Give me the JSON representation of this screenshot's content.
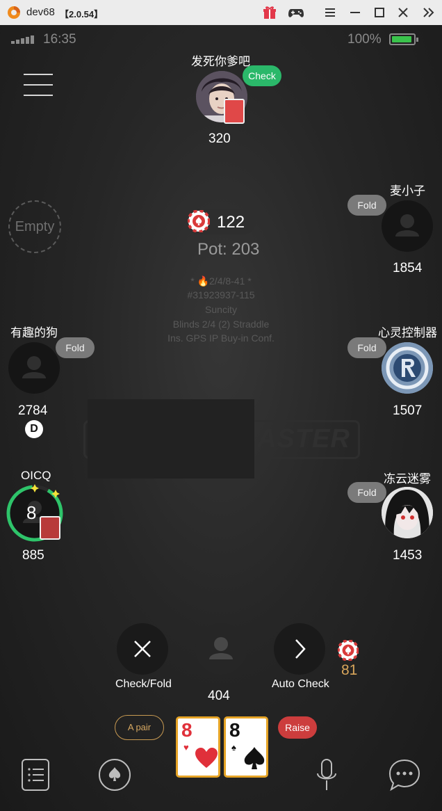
{
  "titlebar": {
    "app_name": "dev68",
    "version": "【2.0.54】",
    "icons": [
      "gift-icon",
      "gamepad-icon",
      "menu-icon",
      "minimize-icon",
      "maximize-icon",
      "close-icon",
      "collapse-icon"
    ]
  },
  "status_bar": {
    "time": "16:35",
    "battery": "100%",
    "battery_level": 1.0
  },
  "seats": {
    "top": {
      "name": "发死你爹吧",
      "stack": "320",
      "action": "Check"
    },
    "right_1": {
      "name": "麦小子",
      "stack": "1854",
      "action": "Fold"
    },
    "right_2": {
      "name": "心灵控制器",
      "stack": "1507",
      "action": "Fold"
    },
    "right_3": {
      "name": "冻云迷雾",
      "stack": "1453",
      "action": "Fold"
    },
    "left_empty": {
      "label": "Empty"
    },
    "left_1": {
      "name": "有趣的狗",
      "stack": "2784",
      "action": "Fold",
      "dealer": "D"
    },
    "left_2": {
      "name": "OICQ",
      "stack": "885",
      "timer": "8"
    },
    "hero": {
      "stack": "404"
    }
  },
  "pot": {
    "current_bet": "122",
    "label": "Pot: 203"
  },
  "table_info": {
    "line1": "* 🔥2/4/8-41 *",
    "line2": "#31923937-115",
    "line3": "Suncity",
    "line4": "Blinds 2/4 (2) Straddle",
    "line5": "Ins. GPS IP Buy-in Conf."
  },
  "watermark": {
    "text": "ASTER"
  },
  "actions": {
    "check_fold": "Check/Fold",
    "auto_check": "Auto Check",
    "bet_amount": "81"
  },
  "hand": {
    "rank_label": "A pair",
    "raise_label": "Raise",
    "cards": [
      {
        "rank": "8",
        "suit": "♥",
        "color": "#e0303a"
      },
      {
        "rank": "8",
        "suit": "♠",
        "color": "#111111"
      }
    ]
  },
  "colors": {
    "check": "#2bb86a",
    "fold": "#7a7a7a",
    "raise": "#cc3d3d",
    "timer": "#2ec46a",
    "card_border": "#e6a426"
  },
  "bottom_bar": [
    "list-icon",
    "spade-icon",
    "microphone-icon",
    "chat-icon"
  ]
}
